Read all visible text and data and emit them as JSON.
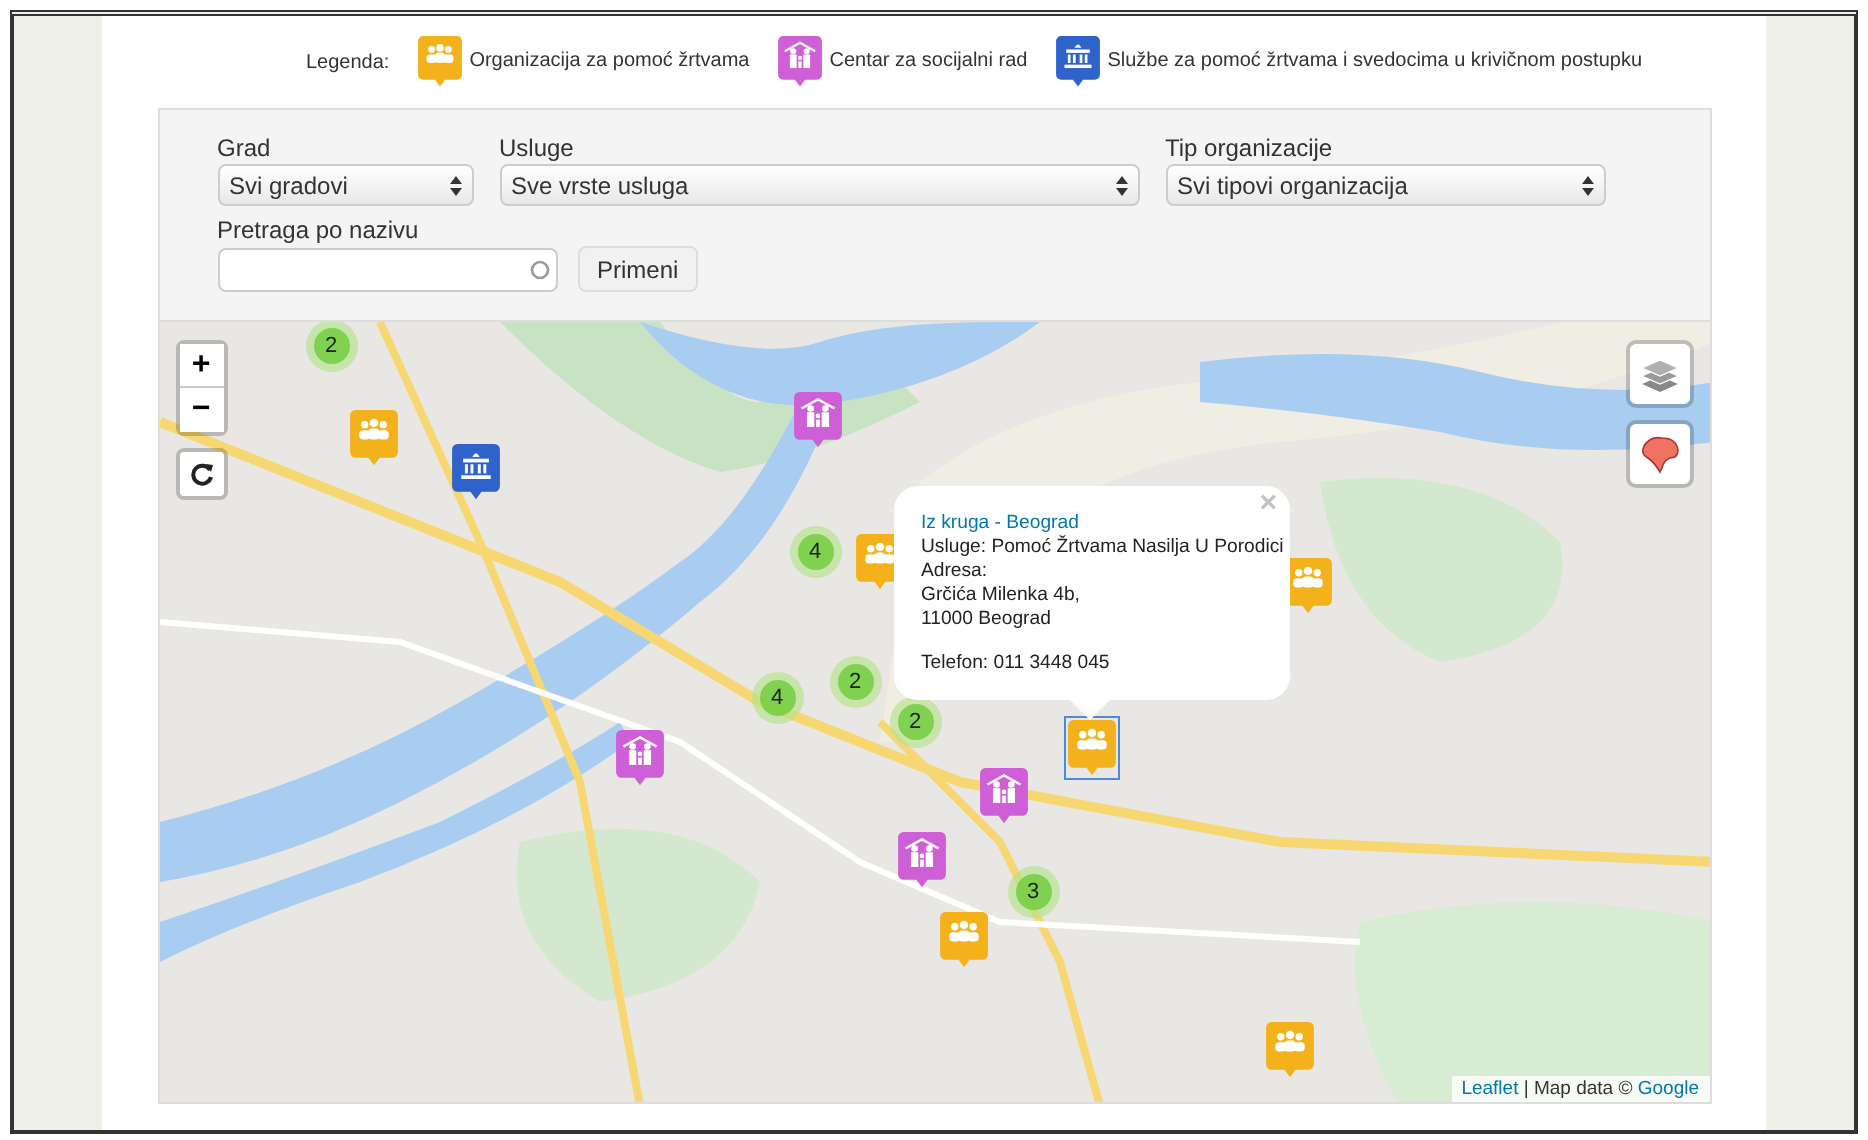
{
  "legend": {
    "label": "Legenda:",
    "items": [
      {
        "kind": "organization",
        "label": "Organizacija za pomoć žrtvama"
      },
      {
        "kind": "social",
        "label": "Centar za socijalni rad"
      },
      {
        "kind": "service",
        "label": "Službe za pomoć žrtvama i svedocima u krivičnom postupku"
      }
    ]
  },
  "filters": {
    "selects": [
      {
        "label": "Grad",
        "value": "Svi gradovi"
      },
      {
        "label": "Usluge",
        "value": "Sve vrste usluga"
      },
      {
        "label": "Tip organizacije",
        "value": "Svi tipovi organizacija"
      }
    ],
    "search": {
      "label": "Pretraga po nazivu"
    },
    "apply_button": "Primeni"
  },
  "map": {
    "zoom_in": "+",
    "zoom_out": "−",
    "clusters": [
      {
        "count": "2"
      },
      {
        "count": "4"
      },
      {
        "count": "2"
      },
      {
        "count": "4"
      },
      {
        "count": "2"
      },
      {
        "count": "3"
      }
    ],
    "markers": [
      {
        "kind": "organization",
        "selected": false
      },
      {
        "kind": "organization",
        "selected": false
      },
      {
        "kind": "organization",
        "selected": false
      },
      {
        "kind": "organization",
        "selected": true
      },
      {
        "kind": "organization",
        "selected": false
      },
      {
        "kind": "organization",
        "selected": false
      },
      {
        "kind": "social",
        "selected": false
      },
      {
        "kind": "social",
        "selected": false
      },
      {
        "kind": "social",
        "selected": false
      },
      {
        "kind": "social",
        "selected": false
      },
      {
        "kind": "service",
        "selected": false
      }
    ],
    "popup": {
      "title": "Iz kruga - Beograd",
      "lines": [
        "Usluge: Pomoć Žrtvama Nasilja U Porodici",
        "Adresa:",
        "Grčića Milenka 4b,",
        "11000 Beograd"
      ],
      "phone": "Telefon: 011 3448 045",
      "close": "×"
    },
    "attribution": {
      "leaflet": "Leaflet",
      "text": "| Map data ©",
      "provider": "Google"
    }
  }
}
